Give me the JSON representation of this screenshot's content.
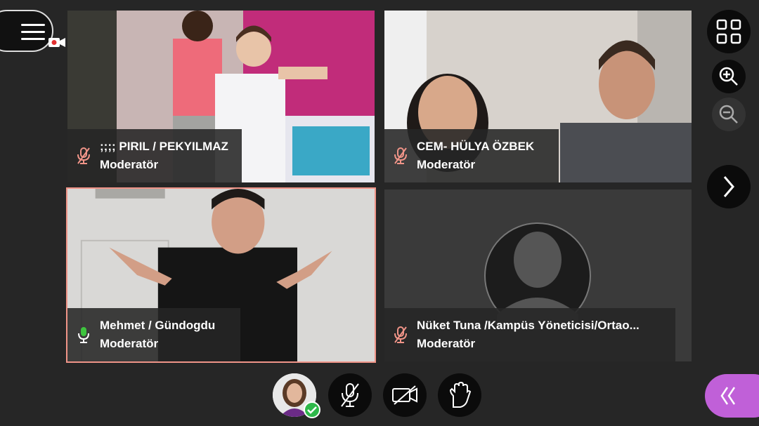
{
  "menu": {
    "icon": "hamburger-icon",
    "recording_icon": "recording-icon"
  },
  "tiles": [
    {
      "name": ";;;; PIRIL / PEKYILMAZ",
      "role": "Moderatör",
      "mic": "muted"
    },
    {
      "name": "CEM- HÜLYA ÖZBEK",
      "role": "Moderatör",
      "mic": "muted"
    },
    {
      "name": "Mehmet / Gündogdu",
      "role": "Moderatör",
      "mic": "talking"
    },
    {
      "name": "Nüket Tuna /Kampüs Yöneticisi/Ortao...",
      "role": "Moderatör",
      "mic": "muted"
    }
  ],
  "controls": {
    "grid": "grid-view-icon",
    "zoom_in": "zoom-in-icon",
    "zoom_out": "zoom-out-icon",
    "next": "chevron-right-icon",
    "mic": "mic-off-icon",
    "camera": "camera-off-icon",
    "hand": "raise-hand-icon",
    "drawer": "chevron-left-double-icon"
  },
  "colors": {
    "background": "#262626",
    "muted_icon": "#f09488",
    "talking_icon": "#3ec43e",
    "active_border": "#f09488",
    "drawer_accent": "#c060d8",
    "check_badge": "#2eb84a"
  }
}
